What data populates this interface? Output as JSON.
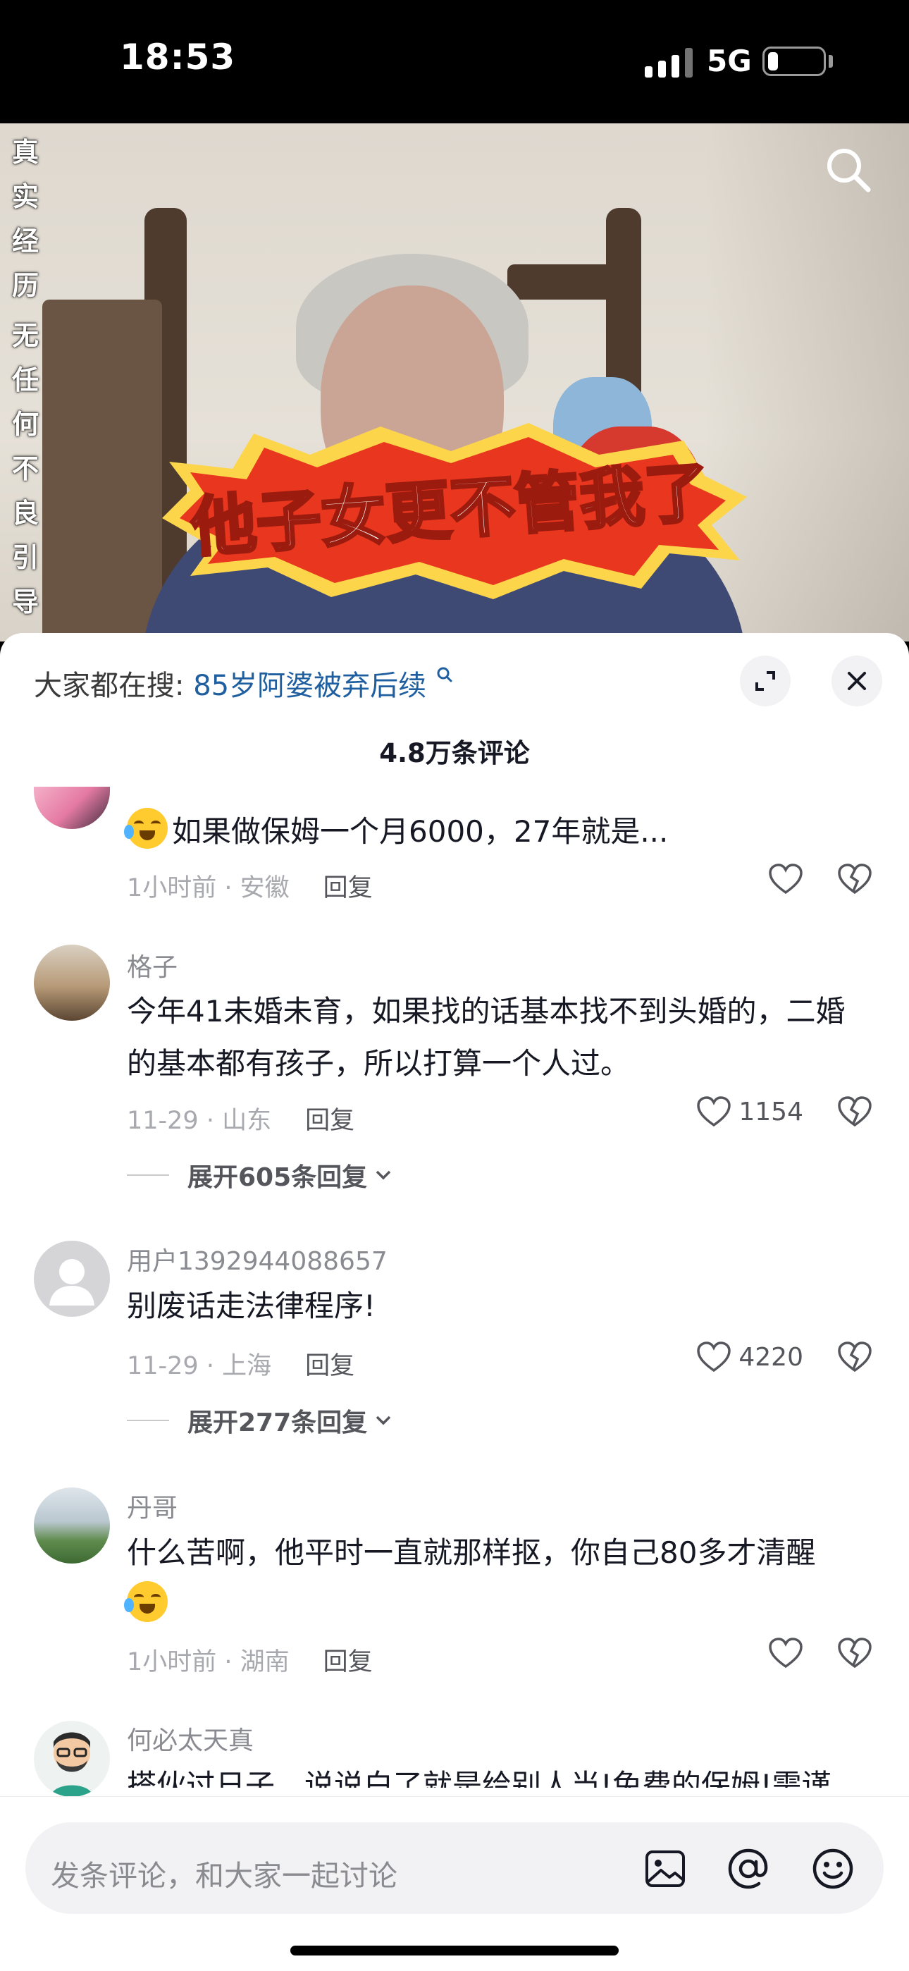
{
  "status_bar": {
    "time": "18:53",
    "network": "5G",
    "battery_level": 0.18
  },
  "video": {
    "vertical_caption": [
      "真",
      "实",
      "经",
      "历",
      "无",
      "任",
      "何",
      "不",
      "良",
      "引",
      "导"
    ],
    "banner_text": "他子女更不管我了",
    "search_icon": "search-icon"
  },
  "comment_panel": {
    "hot_search_prefix": "大家都在搜:",
    "hot_search_term": "85岁阿婆被弃后续",
    "comment_count": "4.8万条评论",
    "expand_icon": "expand-icon",
    "close_icon": "close-icon",
    "comments": [
      {
        "name": "",
        "text": "如果做保姆一个月6000，27年就是...",
        "has_emoji": true,
        "time": "1小时前 · 安徽",
        "reply": "回复",
        "likes": ""
      },
      {
        "name": "格子",
        "text": "今年41未婚未育，如果找的话基本找不到头婚的，二婚的基本都有孩子，所以打算一个人过。",
        "time": "11-29 · 山东",
        "reply": "回复",
        "likes": "1154",
        "expand": "展开605条回复"
      },
      {
        "name": "用户1392944088657",
        "text": "别废话走法律程序!",
        "time": "11-29 · 上海",
        "reply": "回复",
        "likes": "4220",
        "expand": "展开277条回复"
      },
      {
        "name": "丹哥",
        "text": "什么苦啊，他平时一直就那样抠，你自己80多才清醒",
        "time": "1小时前 · 湖南",
        "reply": "回复",
        "likes": ""
      },
      {
        "name": "何必太天真",
        "text": "搭伙过日子，说说白了就是给别人当!免费的保姆!需谨"
      }
    ]
  },
  "input_bar": {
    "placeholder": "发条评论，和大家一起讨论",
    "image_icon": "image-icon",
    "mention_icon": "at-icon",
    "emoji_icon": "emoji-icon"
  }
}
